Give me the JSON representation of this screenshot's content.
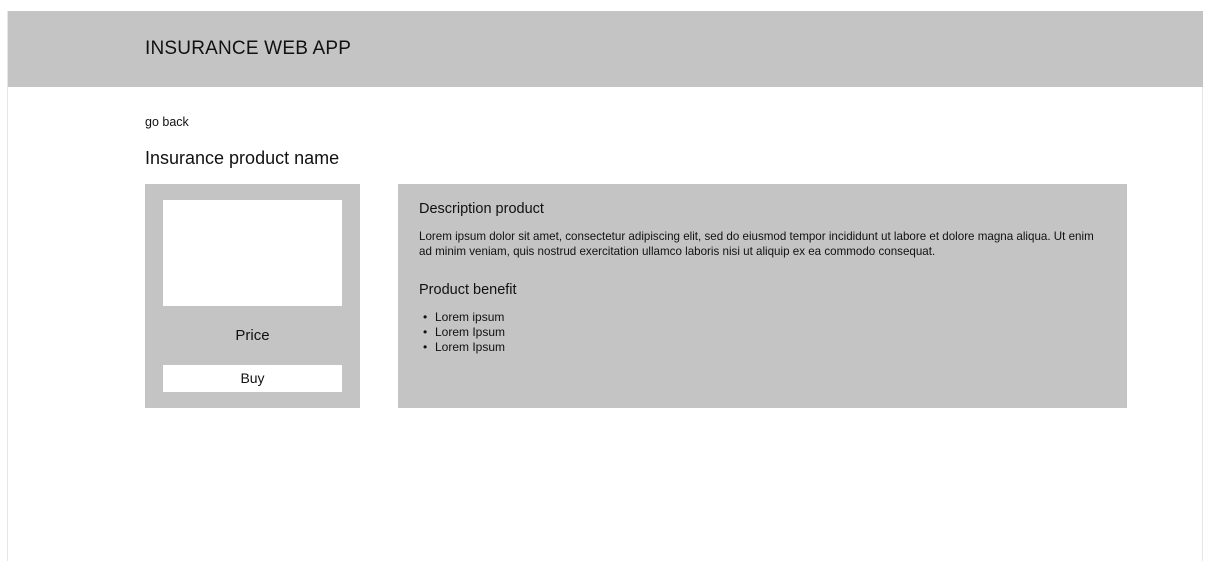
{
  "header": {
    "app_title": "INSURANCE WEB APP"
  },
  "nav": {
    "back_label": "go back"
  },
  "product": {
    "name": "Insurance product name",
    "price_label": "Price",
    "buy_label": "Buy",
    "description_title": "Description product",
    "description_text": "Lorem ipsum dolor sit amet, consectetur adipiscing elit, sed do eiusmod tempor incididunt ut labore et dolore magna aliqua. Ut enim ad minim veniam, quis nostrud exercitation ullamco laboris nisi ut aliquip ex ea commodo consequat.",
    "benefit_title": "Product benefit",
    "benefits": [
      "Lorem ipsum",
      "Lorem Ipsum",
      "Lorem Ipsum"
    ]
  },
  "colors": {
    "panel_gray": "#c4c4c4",
    "background": "#ffffff",
    "text": "#111111"
  }
}
